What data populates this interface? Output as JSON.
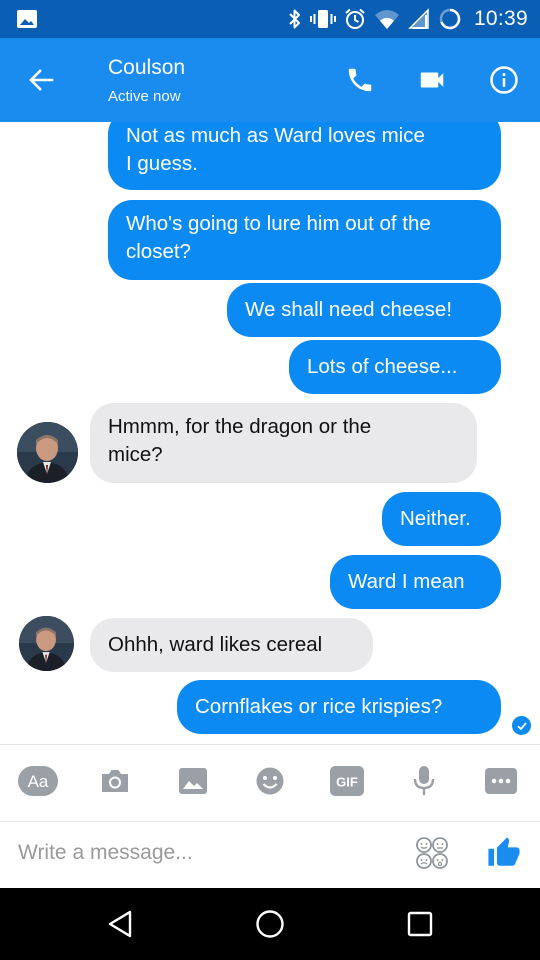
{
  "status_bar": {
    "time": "10:39",
    "icons": [
      "image-notification-icon",
      "bluetooth-icon",
      "vibrate-icon",
      "alarm-icon",
      "wifi-icon",
      "signal-icon",
      "battery-icon"
    ]
  },
  "header": {
    "contact_name": "Coulson",
    "contact_status": "Active now",
    "icons": [
      "back-arrow-icon",
      "phone-icon",
      "video-camera-icon",
      "info-icon"
    ],
    "background": "#1a8cf0",
    "status_bar_background": "#0a5fb4"
  },
  "conversation": {
    "messages": [
      {
        "direction": "outgoing",
        "text_lines": [
          "Not as much as Ward loves mice",
          "I guess."
        ]
      },
      {
        "direction": "outgoing",
        "text_lines": [
          "Who's going to lure him out of the",
          "closet?"
        ]
      },
      {
        "direction": "outgoing",
        "text_lines": [
          "We shall need cheese!"
        ]
      },
      {
        "direction": "outgoing",
        "text_lines": [
          "Lots of cheese..."
        ]
      },
      {
        "direction": "incoming",
        "text_lines": [
          "Hmmm, for the dragon or the",
          "mice?"
        ]
      },
      {
        "direction": "outgoing",
        "text_lines": [
          "Neither."
        ]
      },
      {
        "direction": "outgoing",
        "text_lines": [
          "Ward I mean"
        ]
      },
      {
        "direction": "incoming",
        "text_lines": [
          "Ohhh, ward likes cereal"
        ]
      },
      {
        "direction": "outgoing",
        "text_lines": [
          "Cornflakes or rice krispies?"
        ]
      }
    ],
    "outgoing_color": "#0b8af3",
    "incoming_color": "#e9e9eb",
    "seen_indicator": "check-circle-icon"
  },
  "composer": {
    "tools": [
      "text-format-icon",
      "camera-icon",
      "image-icon",
      "emoji-icon",
      "gif-icon",
      "microphone-icon",
      "more-icon"
    ],
    "input_placeholder": "Write a message...",
    "sticker_icon": "sticker-icon",
    "like_icon": "thumbs-up-icon",
    "accent": "#1a8cf0"
  },
  "nav_bar": {
    "icons": [
      "nav-back-icon",
      "nav-home-icon",
      "nav-recents-icon"
    ]
  }
}
